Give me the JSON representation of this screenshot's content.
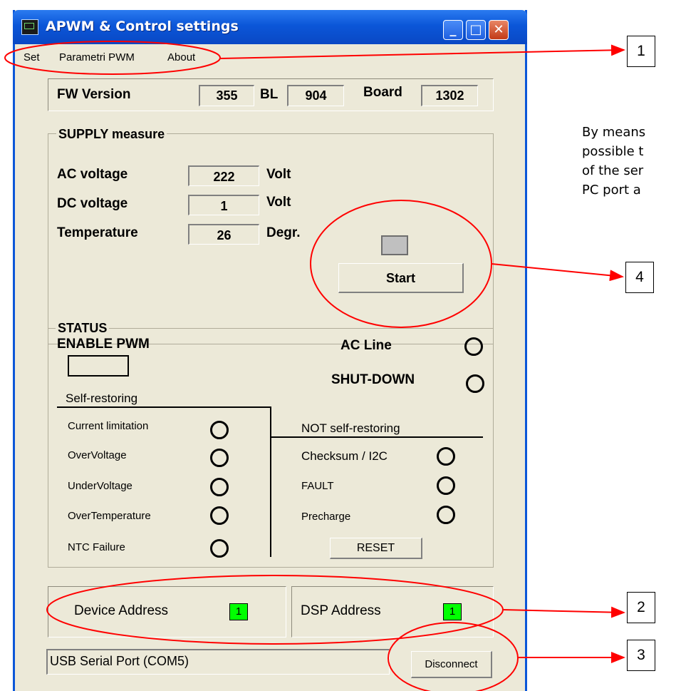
{
  "window": {
    "title": "APWM & Control  settings"
  },
  "menu": {
    "items": [
      "Set",
      "Parametri PWM",
      "About"
    ]
  },
  "firmware": {
    "fw_label": "FW Version",
    "fw_value": "355",
    "bl_label": "BL",
    "bl_value": "904",
    "board_label": "Board",
    "board_value": "1302"
  },
  "supply": {
    "title": "SUPPLY measure",
    "ac_label": "AC voltage",
    "ac_value": "222",
    "ac_unit": "Volt",
    "dc_label": "DC voltage",
    "dc_value": "1",
    "dc_unit": "Volt",
    "temp_label": "Temperature",
    "temp_value": "26",
    "temp_unit": "Degr.",
    "start_label": "Start"
  },
  "status": {
    "title": "STATUS",
    "enable_pwm_label": "ENABLE PWM",
    "ac_line_label": "AC Line",
    "shutdown_label": "SHUT-DOWN",
    "self_restoring_label": "Self-restoring",
    "not_self_restoring_label": "NOT self-restoring",
    "self_restoring_items": [
      "Current limitation",
      "OverVoltage",
      "UnderVoltage",
      "OverTemperature",
      "NTC Failure"
    ],
    "not_self_restoring_items": [
      "Checksum / I2C",
      "FAULT",
      "Precharge"
    ],
    "reset_label": "RESET"
  },
  "addresses": {
    "device_label": "Device Address",
    "device_value": "1",
    "dsp_label": "DSP Address",
    "dsp_value": "1",
    "led_color": "#00ff00"
  },
  "connection": {
    "port": "USB Serial Port (COM5)",
    "disconnect_label": "Disconnect"
  },
  "annotations": {
    "callouts": [
      "1",
      "4",
      "2",
      "3"
    ],
    "note_lines": [
      "By means",
      "possible t",
      "of the ser",
      "PC port a"
    ],
    "arrow_color": "#ff0000"
  }
}
